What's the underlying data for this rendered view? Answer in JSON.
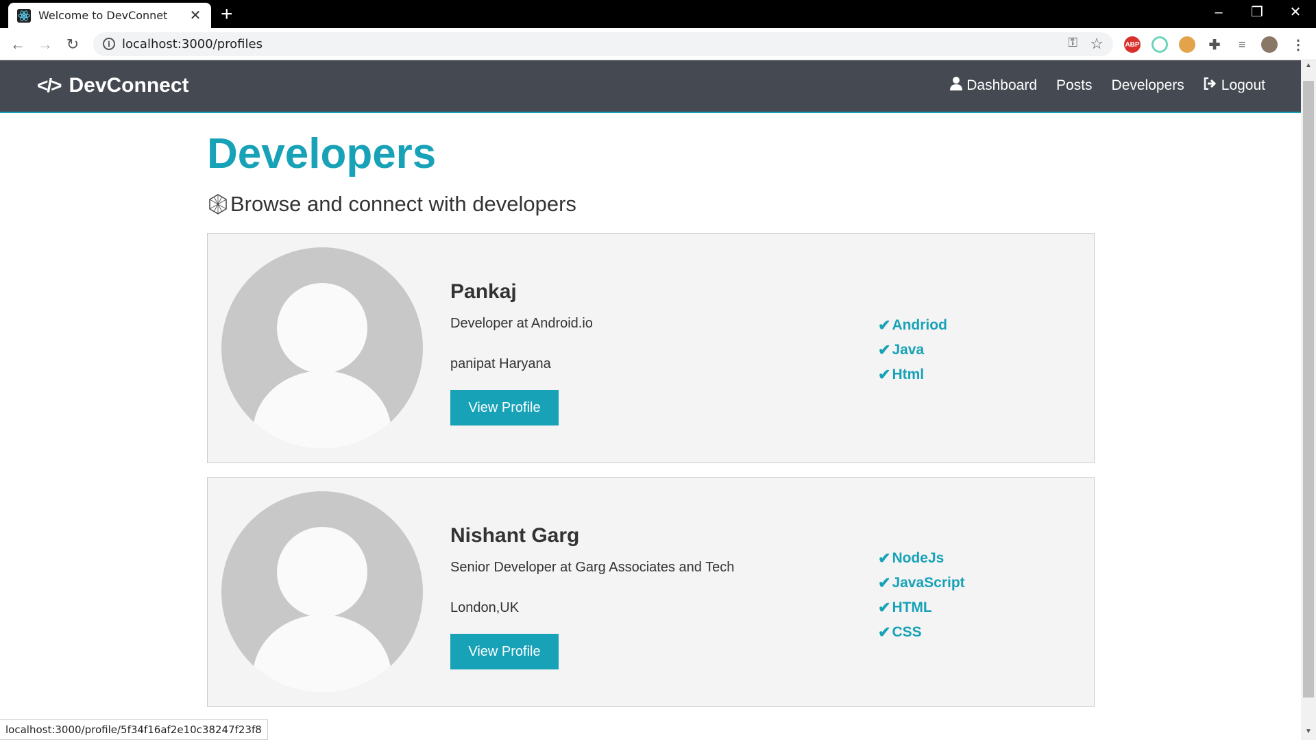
{
  "browser": {
    "tab_title": "Welcome to DevConnet",
    "url": "localhost:3000/profiles",
    "status_url": "localhost:3000/profile/5f34f16af2e10c38247f23f8",
    "extensions": [
      "ABP"
    ]
  },
  "navbar": {
    "brand": "DevConnect",
    "links": {
      "dashboard": "Dashboard",
      "posts": "Posts",
      "developers": "Developers",
      "logout": "Logout"
    }
  },
  "page": {
    "title": "Developers",
    "lead": "Browse and connect with developers"
  },
  "profiles": [
    {
      "name": "Pankaj",
      "status": "Developer at Android.io",
      "location": "panipat Haryana",
      "button": "View Profile",
      "skills": [
        "Andriod",
        "Java",
        "Html"
      ]
    },
    {
      "name": "Nishant Garg",
      "status": "Senior Developer at Garg Associates and Tech",
      "location": "London,UK",
      "button": "View Profile",
      "skills": [
        "NodeJs",
        "JavaScript",
        "HTML",
        "CSS"
      ]
    }
  ],
  "colors": {
    "accent": "#17a2b8",
    "navbar": "#454a52"
  }
}
